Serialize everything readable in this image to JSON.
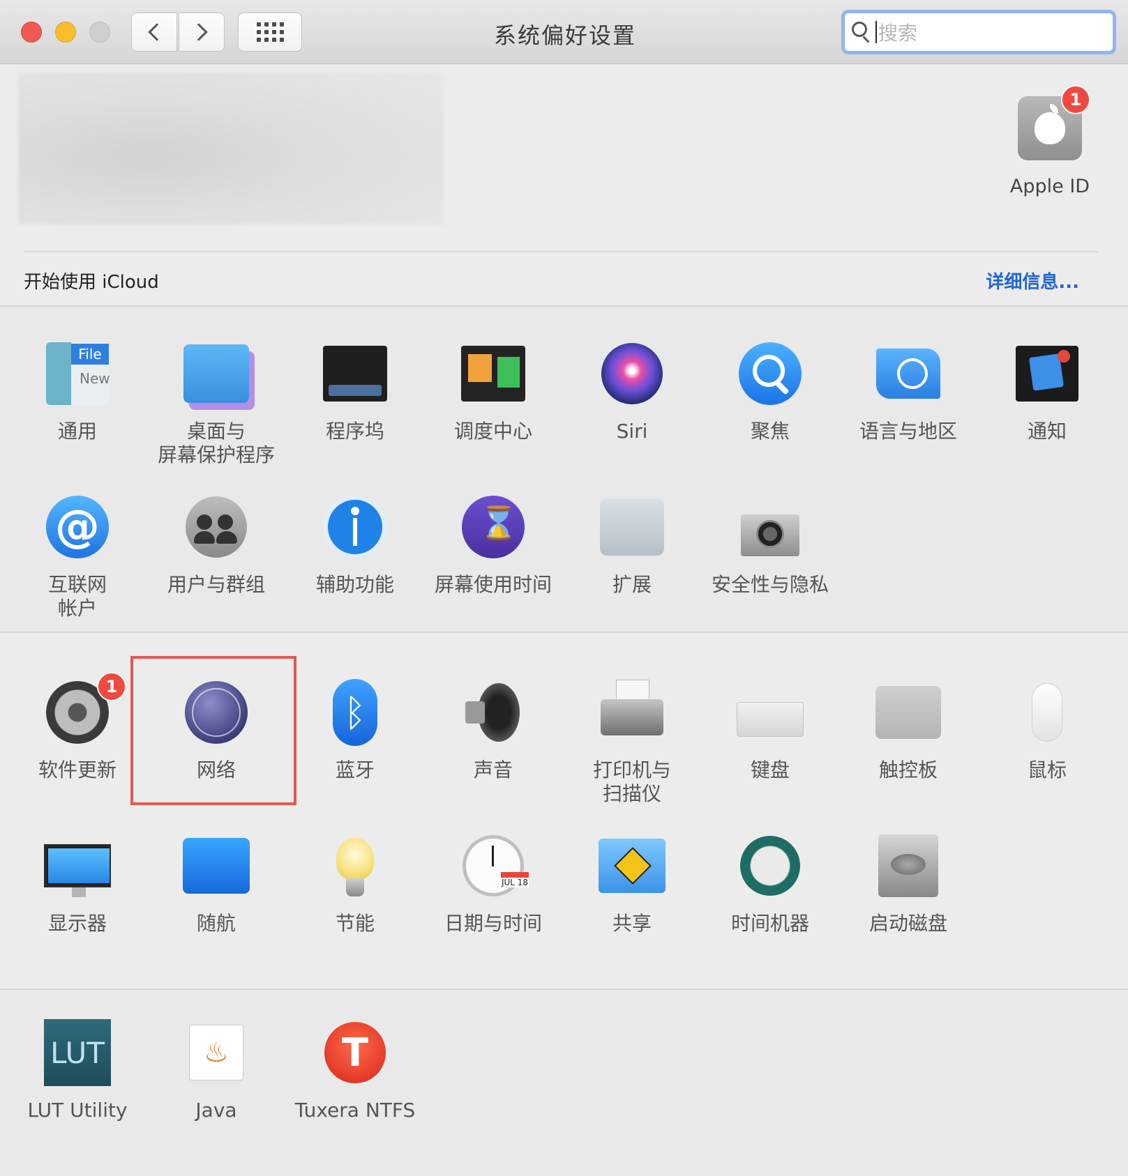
{
  "window": {
    "title": "系统偏好设置"
  },
  "search": {
    "placeholder": "搜索"
  },
  "account": {
    "apple_id_label": "Apple ID",
    "apple_id_badge": "1",
    "icloud_prompt": "开始使用 iCloud",
    "details_link": "详细信息..."
  },
  "sections": [
    {
      "items": [
        {
          "label": "通用",
          "icon": "general-icon"
        },
        {
          "label": "桌面与\n屏幕保护程序",
          "icon": "desktop-screensaver-icon"
        },
        {
          "label": "程序坞",
          "icon": "dock-icon"
        },
        {
          "label": "调度中心",
          "icon": "mission-control-icon"
        },
        {
          "label": "Siri",
          "icon": "siri-icon"
        },
        {
          "label": "聚焦",
          "icon": "spotlight-icon"
        },
        {
          "label": "语言与地区",
          "icon": "language-region-icon"
        },
        {
          "label": "通知",
          "icon": "notifications-icon"
        },
        {
          "label": "互联网\n帐户",
          "icon": "internet-accounts-icon"
        },
        {
          "label": "用户与群组",
          "icon": "users-groups-icon"
        },
        {
          "label": "辅助功能",
          "icon": "accessibility-icon"
        },
        {
          "label": "屏幕使用时间",
          "icon": "screen-time-icon"
        },
        {
          "label": "扩展",
          "icon": "extensions-icon"
        },
        {
          "label": "安全性与隐私",
          "icon": "security-privacy-icon"
        }
      ]
    },
    {
      "items": [
        {
          "label": "软件更新",
          "icon": "software-update-icon",
          "badge": "1"
        },
        {
          "label": "网络",
          "icon": "network-icon",
          "highlighted": true
        },
        {
          "label": "蓝牙",
          "icon": "bluetooth-icon"
        },
        {
          "label": "声音",
          "icon": "sound-icon"
        },
        {
          "label": "打印机与\n扫描仪",
          "icon": "printers-scanners-icon"
        },
        {
          "label": "键盘",
          "icon": "keyboard-icon"
        },
        {
          "label": "触控板",
          "icon": "trackpad-icon"
        },
        {
          "label": "鼠标",
          "icon": "mouse-icon"
        },
        {
          "label": "显示器",
          "icon": "displays-icon"
        },
        {
          "label": "随航",
          "icon": "sidecar-icon"
        },
        {
          "label": "节能",
          "icon": "energy-saver-icon"
        },
        {
          "label": "日期与时间",
          "icon": "date-time-icon"
        },
        {
          "label": "共享",
          "icon": "sharing-icon"
        },
        {
          "label": "时间机器",
          "icon": "time-machine-icon"
        },
        {
          "label": "启动磁盘",
          "icon": "startup-disk-icon"
        }
      ]
    },
    {
      "items": [
        {
          "label": "LUT Utility",
          "icon": "lut-utility-icon",
          "icon_text": "LUT"
        },
        {
          "label": "Java",
          "icon": "java-icon"
        },
        {
          "label": "Tuxera NTFS",
          "icon": "tuxera-ntfs-icon",
          "icon_text": "T"
        }
      ]
    }
  ],
  "colors": {
    "highlight_box": "#e05a55",
    "badge": "#ee4a3f",
    "link": "#2166d0"
  }
}
